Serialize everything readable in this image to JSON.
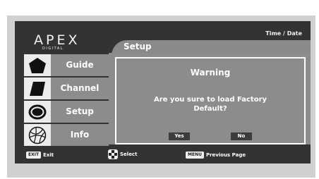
{
  "brand": {
    "logo": "APEX",
    "subtext": "DIGITAL"
  },
  "header": {
    "time_date": "Time / Date",
    "section_title": "Setup"
  },
  "menu": [
    {
      "label": "Guide",
      "icon": "guide-icon"
    },
    {
      "label": "Channel",
      "icon": "channel-icon"
    },
    {
      "label": "Setup",
      "icon": "setup-icon"
    },
    {
      "label": "Info",
      "icon": "info-icon"
    }
  ],
  "dialog": {
    "title": "Warning",
    "message_line1": "Are you sure to load Factory",
    "message_line2": "Default?",
    "yes_label": "Yes",
    "no_label": "No"
  },
  "footer": {
    "exit_key": "EXIT",
    "exit_label": "Exit",
    "select_label": "Select",
    "menu_key": "MENU",
    "menu_label": "Previous Page"
  },
  "colors": {
    "panel": "#333333",
    "content": "#8c8c8c",
    "highlight": "#ececec"
  }
}
